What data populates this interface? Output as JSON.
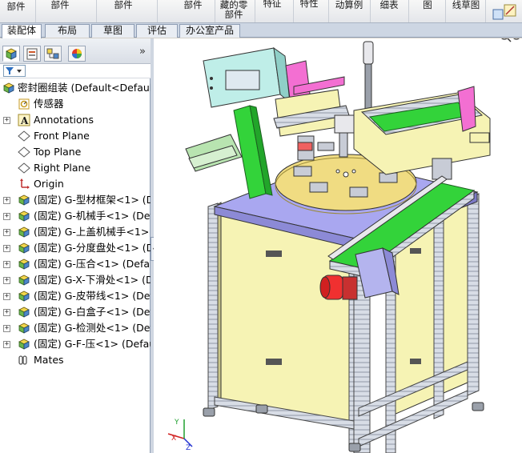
{
  "ribbon": {
    "items": [
      "部件",
      "部件",
      "部件",
      "部件",
      "藏的零",
      "部件",
      "特征",
      "特性",
      "动算例",
      "细表",
      "图",
      "线草图"
    ]
  },
  "tabs": [
    "装配体",
    "布局",
    "草图",
    "评估",
    "办公室产品"
  ],
  "active_tab": "装配体",
  "tree": {
    "root": "密封圈组装 (Default<Default",
    "items": [
      {
        "label": "传感器",
        "icon": "sensor-icon"
      },
      {
        "label": "Annotations",
        "icon": "annotations-icon"
      },
      {
        "label": "Front Plane",
        "icon": "plane-icon"
      },
      {
        "label": "Top Plane",
        "icon": "plane-icon"
      },
      {
        "label": "Right Plane",
        "icon": "plane-icon"
      },
      {
        "label": "Origin",
        "icon": "origin-icon"
      },
      {
        "label": "(固定) G-型材框架<1> (De",
        "icon": "assembly-icon"
      },
      {
        "label": "(固定) G-机械手<1> (Defa",
        "icon": "assembly-icon"
      },
      {
        "label": "(固定) G-上盖机械手<1> (",
        "icon": "assembly-icon"
      },
      {
        "label": "(固定) G-分度盘处<1> (De",
        "icon": "assembly-icon"
      },
      {
        "label": "(固定) G-压合<1> (Defaul",
        "icon": "assembly-icon"
      },
      {
        "label": "(固定) G-X-下滑处<1> (De",
        "icon": "assembly-icon"
      },
      {
        "label": "(固定) G-皮带线<1> (Defa",
        "icon": "assembly-icon"
      },
      {
        "label": "(固定) G-白盒子<1> (Defa",
        "icon": "assembly-icon"
      },
      {
        "label": "(固定) G-检测处<1> (Defa",
        "icon": "assembly-icon"
      },
      {
        "label": "(固定) G-F-压<1> (Defaul",
        "icon": "assembly-icon"
      },
      {
        "label": "Mates",
        "icon": "mates-icon"
      }
    ]
  },
  "panel": {
    "expand_glyph": "»",
    "splitter_glyph": "‹"
  },
  "triad": {
    "x": "X",
    "y": "Y",
    "z": "Z"
  }
}
